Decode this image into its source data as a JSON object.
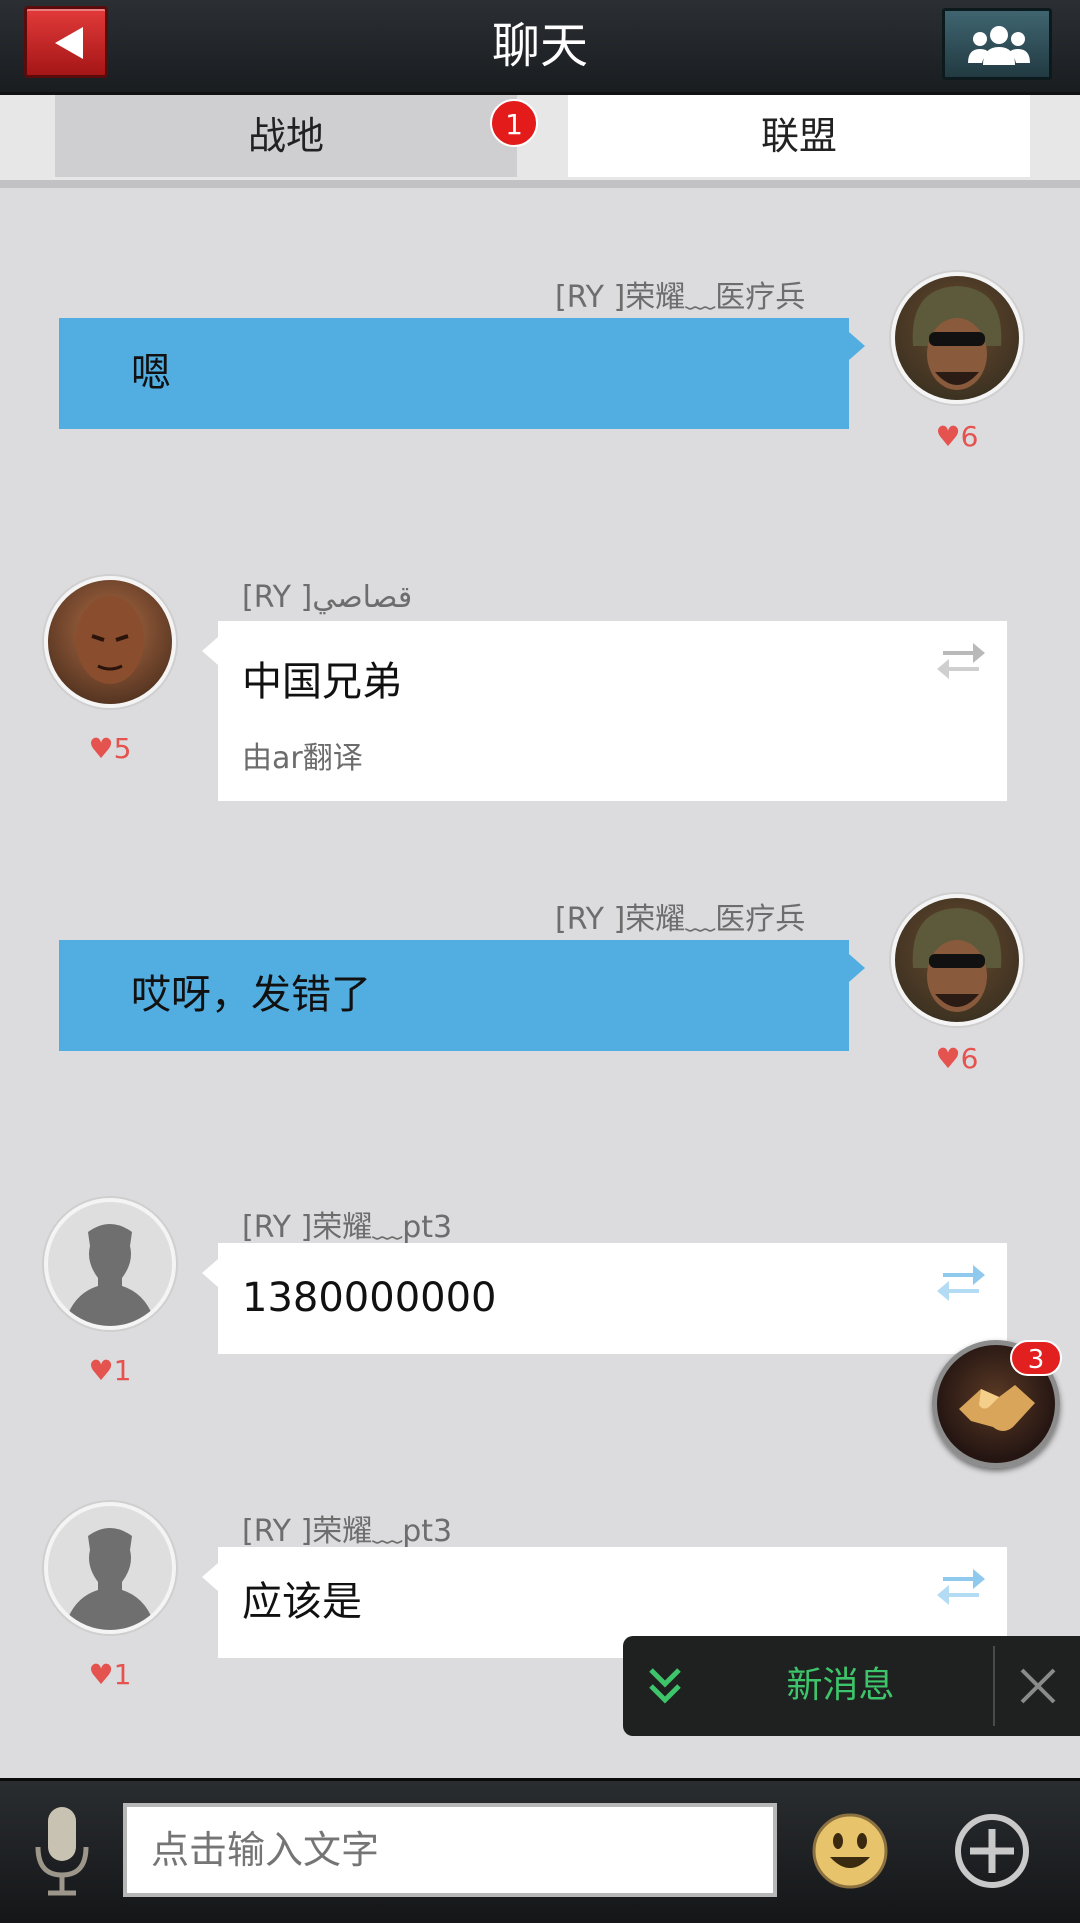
{
  "header": {
    "title": "聊天"
  },
  "tabs": [
    {
      "label": "战地",
      "badge": "1",
      "selected": false
    },
    {
      "label": "联盟",
      "selected": true
    }
  ],
  "messages": [
    {
      "direction": "out",
      "sender": "[RY ]荣耀﹏医疗兵",
      "text": "嗯",
      "likes": "6"
    },
    {
      "direction": "in",
      "sender": "[RY ]قصاصي",
      "text": "中国兄弟",
      "translation": "由ar翻译",
      "likes": "5"
    },
    {
      "direction": "out",
      "sender": "[RY ]荣耀﹏医疗兵",
      "text": "哎呀，发错了",
      "likes": "6"
    },
    {
      "direction": "in",
      "sender": "[RY ]荣耀﹏pt3",
      "text": "1380000000",
      "likes": "1"
    },
    {
      "direction": "in",
      "sender": "[RY ]荣耀﹏pt3",
      "text": "应该是",
      "likes": "1"
    }
  ],
  "floating": {
    "badge": "3",
    "icon": "handshake-icon"
  },
  "toast": {
    "label": "新消息"
  },
  "input": {
    "placeholder": "点击输入文字"
  },
  "colors": {
    "bubble_out": "#52aee1",
    "like": "#e5534f",
    "toast_text": "#3ec46a",
    "badge": "#e41b1b"
  }
}
